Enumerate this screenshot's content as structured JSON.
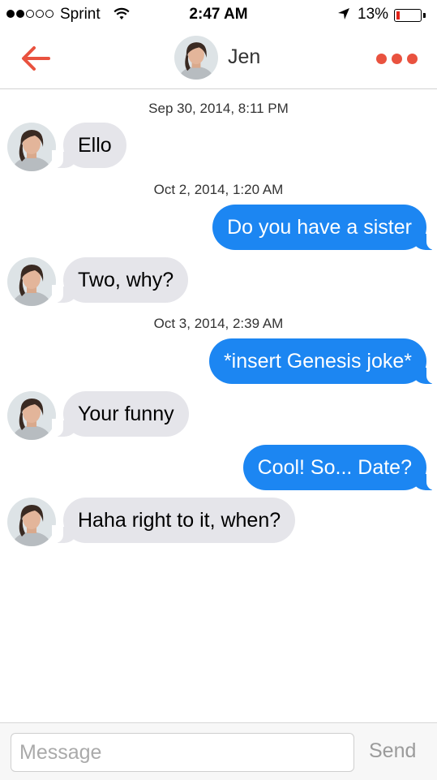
{
  "status_bar": {
    "carrier": "Sprint",
    "time": "2:47 AM",
    "battery_percent": "13%",
    "battery_level": 0.13,
    "signal_bars": 2,
    "signal_total": 5
  },
  "nav": {
    "back_icon": "back-arrow-icon",
    "contact_name": "Jen",
    "more_icon": "more-dots-icon",
    "accent_color": "#e9523f"
  },
  "messages": [
    {
      "timestamp": "Sep 30, 2014, 8:11 PM"
    },
    {
      "from": "them",
      "text": "Ello"
    },
    {
      "timestamp": "Oct 2, 2014, 1:20 AM"
    },
    {
      "from": "me",
      "text": "Do you have a sister"
    },
    {
      "from": "them",
      "text": "Two, why?"
    },
    {
      "timestamp": "Oct 3, 2014, 2:39 AM"
    },
    {
      "from": "me",
      "text": "*insert Genesis joke*"
    },
    {
      "from": "them",
      "text": "Your funny"
    },
    {
      "from": "me",
      "text": "Cool! So... Date?"
    },
    {
      "from": "them",
      "text": "Haha right to it, when?"
    }
  ],
  "compose": {
    "placeholder": "Message",
    "value": "",
    "send_label": "Send"
  },
  "colors": {
    "outgoing_bubble": "#1c86f2",
    "incoming_bubble": "#e5e5ea"
  }
}
